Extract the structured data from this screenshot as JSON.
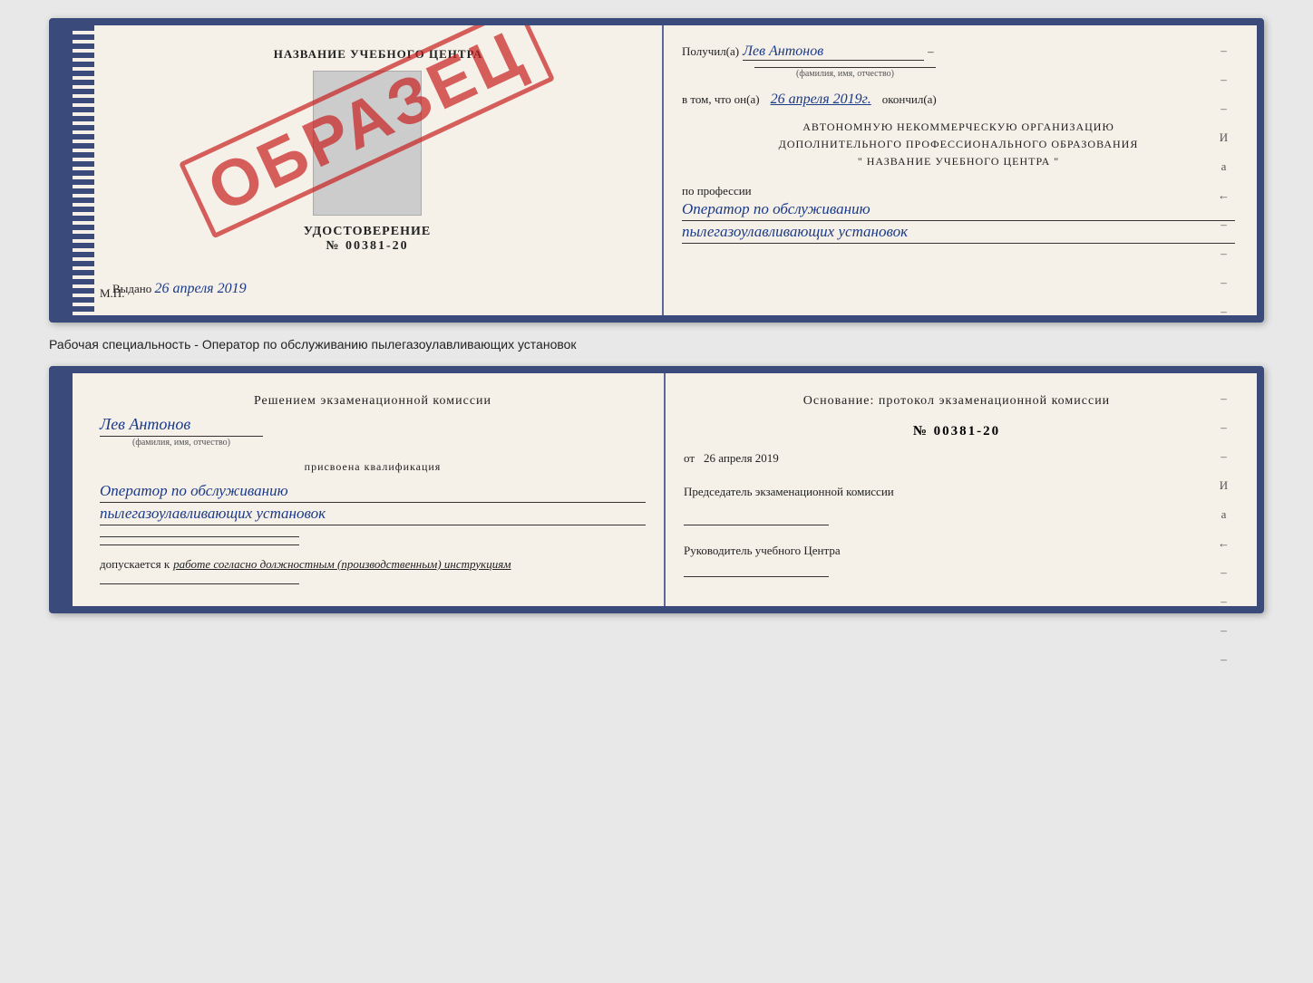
{
  "top_book": {
    "left_page": {
      "header": "НАЗВАНИЕ УЧЕБНОГО ЦЕНТРА",
      "cert_title": "УДОСТОВЕРЕНИЕ",
      "cert_number": "№ 00381-20",
      "issued_label": "Выдано",
      "issued_date": "26 апреля 2019",
      "mp_label": "М.П.",
      "stamp": "ОБРАЗЕЦ"
    },
    "right_page": {
      "received_label": "Получил(а)",
      "recipient_name": "Лев Антонов",
      "recipient_sub": "(фамилия, имя, отчество)",
      "dash": "–",
      "date_prefix": "в том, что он(а)",
      "date_value": "26 апреля 2019г.",
      "finished_label": "окончил(а)",
      "org_line1": "АВТОНОМНУЮ НЕКОММЕРЧЕСКУЮ ОРГАНИЗАЦИЮ",
      "org_line2": "ДОПОЛНИТЕЛЬНОГО ПРОФЕССИОНАЛЬНОГО ОБРАЗОВАНИЯ",
      "org_line3": "\"   НАЗВАНИЕ УЧЕБНОГО ЦЕНТРА   \"",
      "profession_prefix": "по профессии",
      "profession_line1": "Оператор по обслуживанию",
      "profession_line2": "пылегазоулавливающих установок"
    }
  },
  "middle_label": "Рабочая специальность - Оператор по обслуживанию пылегазоулавливающих установок",
  "bottom_book": {
    "left_page": {
      "decision_prefix": "Решением экзаменационной комиссии",
      "person_name": "Лев Антонов",
      "person_sub": "(фамилия, имя, отчество)",
      "qualification_prefix": "присвоена квалификация",
      "qualification_line1": "Оператор по обслуживанию",
      "qualification_line2": "пылегазоулавливающих установок",
      "admission_label": "допускается к",
      "admission_text": "работе согласно должностным (производственным) инструкциям"
    },
    "right_page": {
      "basis_prefix": "Основание: протокол экзаменационной комиссии",
      "protocol_number": "№  00381-20",
      "date_prefix": "от",
      "date_value": "26 апреля 2019",
      "chairman_label": "Председатель экзаменационной комиссии",
      "director_label": "Руководитель учебного Центра"
    }
  }
}
